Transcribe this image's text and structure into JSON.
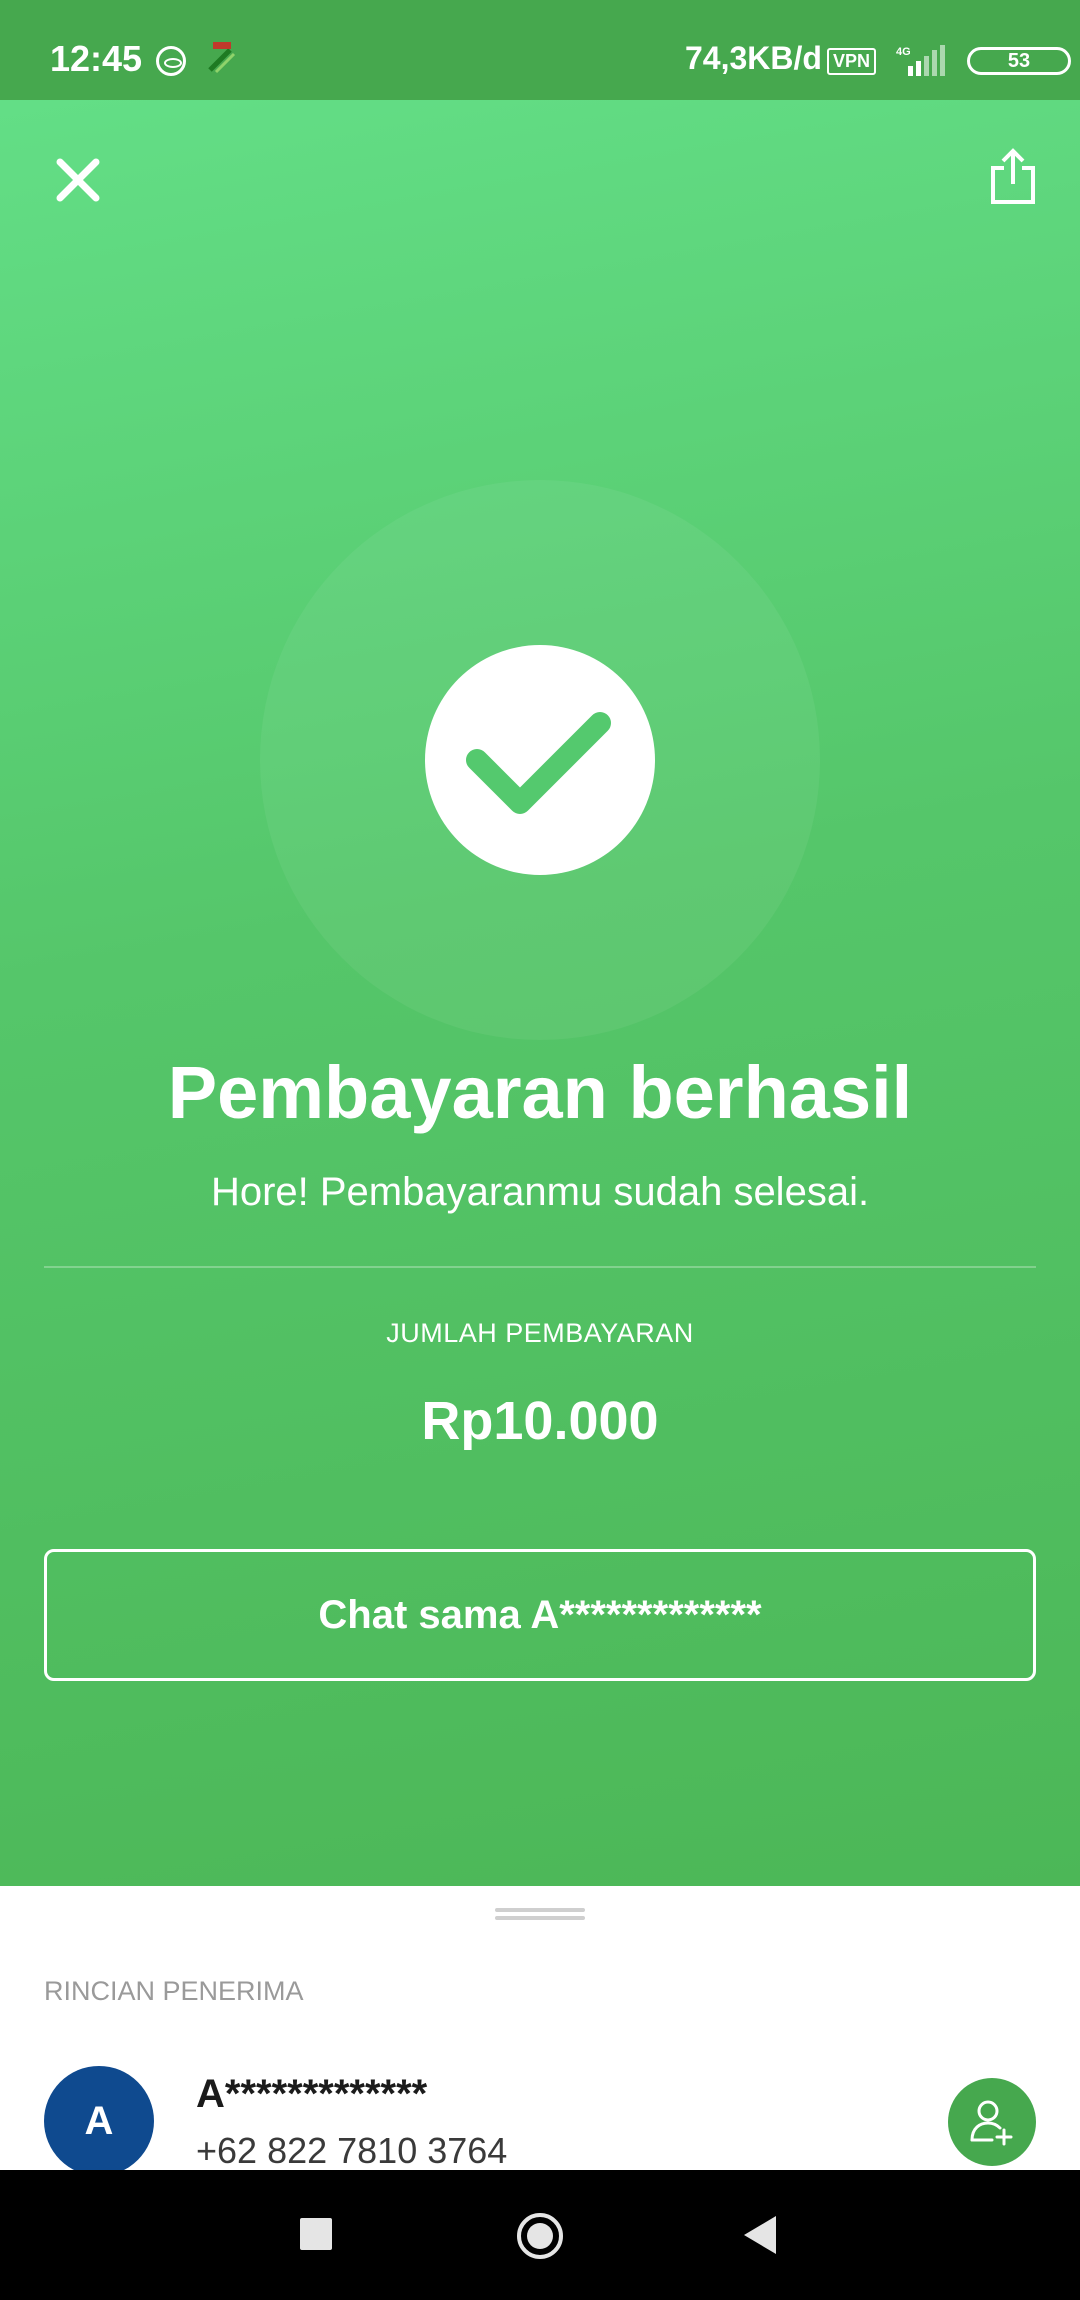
{
  "status_bar": {
    "time": "12:45",
    "data_speed": "74,3KB/d",
    "vpn_label": "VPN",
    "network_label": "4G",
    "battery_level": "53"
  },
  "header": {
    "close_icon": "close-icon",
    "share_icon": "share-icon"
  },
  "success": {
    "icon": "checkmark-icon",
    "title": "Pembayaran berhasil",
    "subtitle": "Hore! Pembayaranmu sudah selesai.",
    "amount_label": "JUMLAH PEMBAYARAN",
    "amount": "Rp10.000",
    "chat_button_label": "Chat sama A*************"
  },
  "recipient": {
    "section_label": "RINCIAN PENERIMA",
    "avatar_initial": "A",
    "name": "A*************",
    "phone": "+62 822 7810 3764",
    "add_contact_icon": "add-contact-icon"
  },
  "colors": {
    "status_bar": "#46a84e",
    "hero_top": "#63de86",
    "hero_bottom": "#4cb757",
    "avatar": "#0f4a8f",
    "accent": "#46a84e"
  }
}
